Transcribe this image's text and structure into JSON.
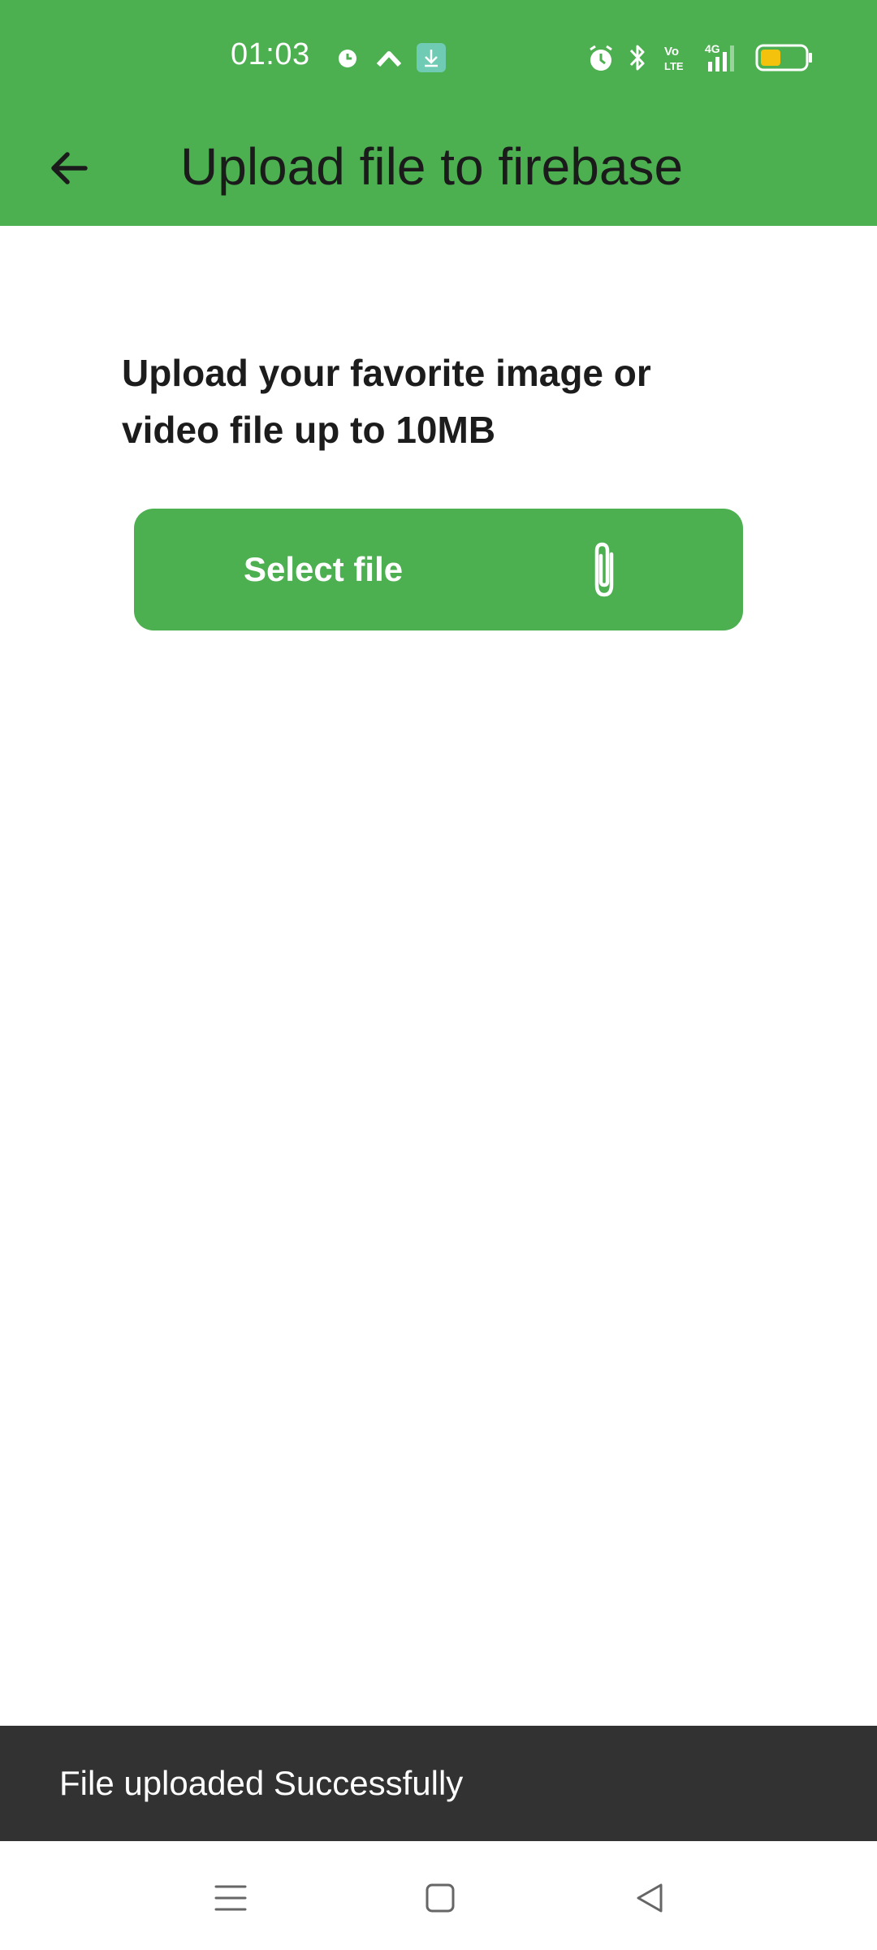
{
  "colors": {
    "primary": "#4caf50",
    "snackbar_bg": "#323232",
    "battery_fill": "#f4c20d"
  },
  "status_bar": {
    "time": "01:03",
    "left_icons": [
      "data-saver-icon",
      "chevron-up-icon",
      "download-icon"
    ],
    "right_icons": [
      "alarm-icon",
      "bluetooth-icon",
      "volte-icon",
      "signal-4g-icon",
      "battery-icon"
    ]
  },
  "app_bar": {
    "title": "Upload file to firebase",
    "back_icon": "arrow-left-icon"
  },
  "main": {
    "instruction": "Upload your favorite image or video file up to 10MB",
    "select_button_label": "Select file",
    "select_button_icon": "paperclip-icon"
  },
  "snackbar": {
    "message": "File uploaded Successfully"
  },
  "nav_bar": {
    "icons": [
      "menu-icon",
      "home-icon",
      "back-triangle-icon"
    ]
  }
}
